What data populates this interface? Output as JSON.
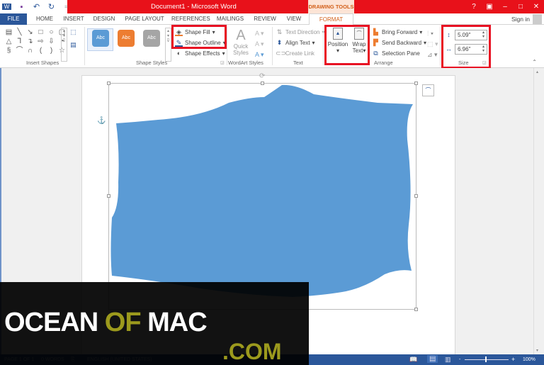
{
  "window": {
    "title": "Document1 -  Microsoft Word",
    "context_tab": "DRAWING TOOLS",
    "controls": [
      "?",
      "ribbon-display",
      "minimize",
      "maximize",
      "close"
    ]
  },
  "qat": {
    "icons": [
      "word-logo-icon",
      "save-icon",
      "undo-icon",
      "redo-icon",
      "customize-icon"
    ]
  },
  "tabs": [
    "FILE",
    "HOME",
    "INSERT",
    "DESIGN",
    "PAGE LAYOUT",
    "REFERENCES",
    "MAILINGS",
    "REVIEW",
    "VIEW",
    "FORMAT"
  ],
  "active_tab": "FORMAT",
  "account": {
    "signin": "Sign in"
  },
  "ribbon": {
    "insert_shapes": {
      "label": "Insert Shapes"
    },
    "shape_styles": {
      "label": "Shape Styles",
      "styles": [
        {
          "text": "Abc",
          "color": "#5b9bd5"
        },
        {
          "text": "Abc",
          "color": "#ed7d31"
        },
        {
          "text": "Abc",
          "color": "#a5a5a5"
        }
      ],
      "fill": "Shape Fill",
      "outline": "Shape Outline",
      "effects": "Shape Effects"
    },
    "wordart": {
      "label": "WordArt Styles",
      "quick": "Quick",
      "styles": "Styles"
    },
    "text": {
      "label": "Text",
      "direction": "Text Direction",
      "align": "Align Text",
      "link": "Create Link"
    },
    "arrange": {
      "label": "Arrange",
      "position": "Position",
      "wrap1": "Wrap",
      "wrap2": "Text",
      "forward": "Bring Forward",
      "backward": "Send Backward",
      "pane": "Selection Pane"
    },
    "size": {
      "label": "Size",
      "height": "5.09\"",
      "width": "6.96\""
    }
  },
  "status": {
    "page": "PAGE 1 OF 1",
    "words": "0 WORDS",
    "lang": "ENGLISH (UNITED STATES)",
    "zoom": "100%",
    "zoom_level": 100
  },
  "watermark": {
    "part1": "OCEAN",
    "part2": "OF",
    "part3": "MAC",
    "part4": ".COM"
  },
  "colors": {
    "accent": "#2b579a",
    "title_red": "#e8111a",
    "shape_fill": "#5b9bd5",
    "highlight": "#e81123"
  }
}
